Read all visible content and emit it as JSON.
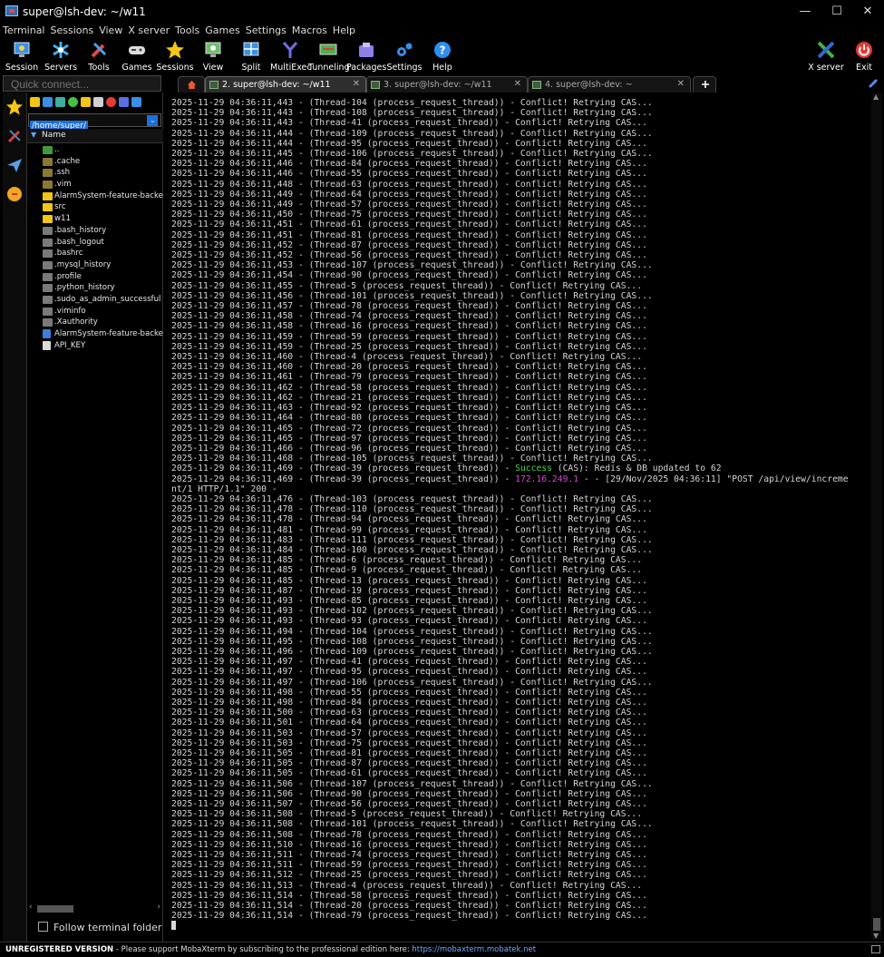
{
  "window": {
    "title": "super@lsh-dev: ~/w11",
    "controls": [
      "—",
      "☐",
      "✕"
    ]
  },
  "menu": [
    "Terminal",
    "Sessions",
    "View",
    "X server",
    "Tools",
    "Games",
    "Settings",
    "Macros",
    "Help"
  ],
  "toolbar": {
    "left": [
      "Session",
      "Servers",
      "Tools",
      "Games",
      "Sessions",
      "View",
      "Split",
      "MultiExec",
      "Tunneling",
      "Packages",
      "Settings",
      "Help"
    ],
    "right": [
      "X server",
      "Exit"
    ]
  },
  "quick_connect": {
    "placeholder": "Quick connect..."
  },
  "tabs": [
    {
      "label": "2. super@lsh-dev: ~/w11",
      "active": true
    },
    {
      "label": "3. super@lsh-dev: ~/w11",
      "active": false
    },
    {
      "label": "4. super@lsh-dev: ~",
      "active": false
    }
  ],
  "sidebar": {
    "path": "/home/super/",
    "column_header": "Name",
    "files": [
      {
        "name": "..",
        "type": "up"
      },
      {
        "name": ".cache",
        "type": "dimfolder"
      },
      {
        "name": ".ssh",
        "type": "dimfolder"
      },
      {
        "name": ".vim",
        "type": "dimfolder"
      },
      {
        "name": "AlarmSystem-feature-backen...",
        "type": "folder"
      },
      {
        "name": "src",
        "type": "folder"
      },
      {
        "name": "w11",
        "type": "folder"
      },
      {
        "name": ".bash_history",
        "type": "file"
      },
      {
        "name": ".bash_logout",
        "type": "file"
      },
      {
        "name": ".bashrc",
        "type": "file"
      },
      {
        "name": ".mysql_history",
        "type": "file"
      },
      {
        "name": ".profile",
        "type": "file"
      },
      {
        "name": ".python_history",
        "type": "file"
      },
      {
        "name": ".sudo_as_admin_successful",
        "type": "file"
      },
      {
        "name": ".viminfo",
        "type": "file"
      },
      {
        "name": ".Xauthority",
        "type": "file"
      },
      {
        "name": "AlarmSystem-feature-backen...",
        "type": "zip"
      },
      {
        "name": "API_KEY",
        "type": "doc"
      }
    ],
    "follow_label": "Follow terminal folder"
  },
  "terminal": {
    "lines_before": [
      "2025-11-29 04:36:11,443 - (Thread-104 (process_request_thread)) - Conflict! Retrying CAS...",
      "2025-11-29 04:36:11,443 - (Thread-108 (process_request_thread)) - Conflict! Retrying CAS...",
      "2025-11-29 04:36:11,443 - (Thread-41 (process_request_thread)) - Conflict! Retrying CAS...",
      "2025-11-29 04:36:11,444 - (Thread-109 (process_request_thread)) - Conflict! Retrying CAS...",
      "2025-11-29 04:36:11,444 - (Thread-95 (process_request_thread)) - Conflict! Retrying CAS...",
      "2025-11-29 04:36:11,445 - (Thread-106 (process_request_thread)) - Conflict! Retrying CAS...",
      "2025-11-29 04:36:11,446 - (Thread-84 (process_request_thread)) - Conflict! Retrying CAS...",
      "2025-11-29 04:36:11,446 - (Thread-55 (process_request_thread)) - Conflict! Retrying CAS...",
      "2025-11-29 04:36:11,448 - (Thread-63 (process_request_thread)) - Conflict! Retrying CAS...",
      "2025-11-29 04:36:11,449 - (Thread-64 (process_request_thread)) - Conflict! Retrying CAS...",
      "2025-11-29 04:36:11,449 - (Thread-57 (process_request_thread)) - Conflict! Retrying CAS...",
      "2025-11-29 04:36:11,450 - (Thread-75 (process_request_thread)) - Conflict! Retrying CAS...",
      "2025-11-29 04:36:11,451 - (Thread-61 (process_request_thread)) - Conflict! Retrying CAS...",
      "2025-11-29 04:36:11,451 - (Thread-81 (process_request_thread)) - Conflict! Retrying CAS...",
      "2025-11-29 04:36:11,452 - (Thread-87 (process_request_thread)) - Conflict! Retrying CAS...",
      "2025-11-29 04:36:11,452 - (Thread-56 (process_request_thread)) - Conflict! Retrying CAS...",
      "2025-11-29 04:36:11,453 - (Thread-107 (process_request_thread)) - Conflict! Retrying CAS...",
      "2025-11-29 04:36:11,454 - (Thread-90 (process_request_thread)) - Conflict! Retrying CAS...",
      "2025-11-29 04:36:11,455 - (Thread-5 (process_request_thread)) - Conflict! Retrying CAS...",
      "2025-11-29 04:36:11,456 - (Thread-101 (process_request_thread)) - Conflict! Retrying CAS...",
      "2025-11-29 04:36:11,457 - (Thread-78 (process_request_thread)) - Conflict! Retrying CAS...",
      "2025-11-29 04:36:11,458 - (Thread-74 (process_request_thread)) - Conflict! Retrying CAS...",
      "2025-11-29 04:36:11,458 - (Thread-16 (process_request_thread)) - Conflict! Retrying CAS...",
      "2025-11-29 04:36:11,459 - (Thread-59 (process_request_thread)) - Conflict! Retrying CAS...",
      "2025-11-29 04:36:11,459 - (Thread-25 (process_request_thread)) - Conflict! Retrying CAS...",
      "2025-11-29 04:36:11,460 - (Thread-4 (process_request_thread)) - Conflict! Retrying CAS...",
      "2025-11-29 04:36:11,460 - (Thread-20 (process_request_thread)) - Conflict! Retrying CAS...",
      "2025-11-29 04:36:11,461 - (Thread-79 (process_request_thread)) - Conflict! Retrying CAS...",
      "2025-11-29 04:36:11,462 - (Thread-58 (process_request_thread)) - Conflict! Retrying CAS...",
      "2025-11-29 04:36:11,462 - (Thread-21 (process_request_thread)) - Conflict! Retrying CAS...",
      "2025-11-29 04:36:11,463 - (Thread-92 (process_request_thread)) - Conflict! Retrying CAS...",
      "2025-11-29 04:36:11,464 - (Thread-80 (process_request_thread)) - Conflict! Retrying CAS...",
      "2025-11-29 04:36:11,465 - (Thread-72 (process_request_thread)) - Conflict! Retrying CAS...",
      "2025-11-29 04:36:11,465 - (Thread-97 (process_request_thread)) - Conflict! Retrying CAS...",
      "2025-11-29 04:36:11,466 - (Thread-96 (process_request_thread)) - Conflict! Retrying CAS...",
      "2025-11-29 04:36:11,468 - (Thread-105 (process_request_thread)) - Conflict! Retrying CAS..."
    ],
    "success_line": {
      "prefix": "2025-11-29 04:36:11,469 - (Thread-39 (process_request_thread)) - ",
      "success": "Success",
      "rest": " (CAS): Redis & DB updated to 62"
    },
    "http_line": {
      "prefix": "2025-11-29 04:36:11,469 - (Thread-39 (process_request_thread)) - ",
      "ip": "172.16.249.1",
      "rest": " - - [29/Nov/2025 04:36:11] \"POST /api/view/increme",
      "wrap": "nt/1 HTTP/1.1\" 200 -"
    },
    "lines_after": [
      "2025-11-29 04:36:11,476 - (Thread-103 (process_request_thread)) - Conflict! Retrying CAS...",
      "2025-11-29 04:36:11,478 - (Thread-110 (process_request_thread)) - Conflict! Retrying CAS...",
      "2025-11-29 04:36:11,478 - (Thread-94 (process_request_thread)) - Conflict! Retrying CAS...",
      "2025-11-29 04:36:11,481 - (Thread-99 (process_request_thread)) - Conflict! Retrying CAS...",
      "2025-11-29 04:36:11,483 - (Thread-111 (process_request_thread)) - Conflict! Retrying CAS...",
      "2025-11-29 04:36:11,484 - (Thread-100 (process_request_thread)) - Conflict! Retrying CAS...",
      "2025-11-29 04:36:11,485 - (Thread-6 (process_request_thread)) - Conflict! Retrying CAS...",
      "2025-11-29 04:36:11,485 - (Thread-9 (process_request_thread)) - Conflict! Retrying CAS...",
      "2025-11-29 04:36:11,485 - (Thread-13 (process_request_thread)) - Conflict! Retrying CAS...",
      "2025-11-29 04:36:11,487 - (Thread-19 (process_request_thread)) - Conflict! Retrying CAS...",
      "2025-11-29 04:36:11,493 - (Thread-85 (process_request_thread)) - Conflict! Retrying CAS...",
      "2025-11-29 04:36:11,493 - (Thread-102 (process_request_thread)) - Conflict! Retrying CAS...",
      "2025-11-29 04:36:11,493 - (Thread-93 (process_request_thread)) - Conflict! Retrying CAS...",
      "2025-11-29 04:36:11,494 - (Thread-104 (process_request_thread)) - Conflict! Retrying CAS...",
      "2025-11-29 04:36:11,495 - (Thread-108 (process_request_thread)) - Conflict! Retrying CAS...",
      "2025-11-29 04:36:11,496 - (Thread-109 (process_request_thread)) - Conflict! Retrying CAS...",
      "2025-11-29 04:36:11,497 - (Thread-41 (process_request_thread)) - Conflict! Retrying CAS...",
      "2025-11-29 04:36:11,497 - (Thread-95 (process_request_thread)) - Conflict! Retrying CAS...",
      "2025-11-29 04:36:11,497 - (Thread-106 (process_request_thread)) - Conflict! Retrying CAS...",
      "2025-11-29 04:36:11,498 - (Thread-55 (process_request_thread)) - Conflict! Retrying CAS...",
      "2025-11-29 04:36:11,498 - (Thread-84 (process_request_thread)) - Conflict! Retrying CAS...",
      "2025-11-29 04:36:11,500 - (Thread-63 (process_request_thread)) - Conflict! Retrying CAS...",
      "2025-11-29 04:36:11,501 - (Thread-64 (process_request_thread)) - Conflict! Retrying CAS...",
      "2025-11-29 04:36:11,503 - (Thread-57 (process_request_thread)) - Conflict! Retrying CAS...",
      "2025-11-29 04:36:11,503 - (Thread-75 (process_request_thread)) - Conflict! Retrying CAS...",
      "2025-11-29 04:36:11,505 - (Thread-81 (process_request_thread)) - Conflict! Retrying CAS...",
      "2025-11-29 04:36:11,505 - (Thread-87 (process_request_thread)) - Conflict! Retrying CAS...",
      "2025-11-29 04:36:11,505 - (Thread-61 (process_request_thread)) - Conflict! Retrying CAS...",
      "2025-11-29 04:36:11,506 - (Thread-107 (process_request_thread)) - Conflict! Retrying CAS...",
      "2025-11-29 04:36:11,506 - (Thread-90 (process_request_thread)) - Conflict! Retrying CAS...",
      "2025-11-29 04:36:11,507 - (Thread-56 (process_request_thread)) - Conflict! Retrying CAS...",
      "2025-11-29 04:36:11,508 - (Thread-5 (process_request_thread)) - Conflict! Retrying CAS...",
      "2025-11-29 04:36:11,508 - (Thread-101 (process_request_thread)) - Conflict! Retrying CAS...",
      "2025-11-29 04:36:11,508 - (Thread-78 (process_request_thread)) - Conflict! Retrying CAS...",
      "2025-11-29 04:36:11,510 - (Thread-16 (process_request_thread)) - Conflict! Retrying CAS...",
      "2025-11-29 04:36:11,511 - (Thread-74 (process_request_thread)) - Conflict! Retrying CAS...",
      "2025-11-29 04:36:11,511 - (Thread-59 (process_request_thread)) - Conflict! Retrying CAS...",
      "2025-11-29 04:36:11,512 - (Thread-25 (process_request_thread)) - Conflict! Retrying CAS...",
      "2025-11-29 04:36:11,513 - (Thread-4 (process_request_thread)) - Conflict! Retrying CAS...",
      "2025-11-29 04:36:11,514 - (Thread-58 (process_request_thread)) - Conflict! Retrying CAS...",
      "2025-11-29 04:36:11,514 - (Thread-20 (process_request_thread)) - Conflict! Retrying CAS...",
      "2025-11-29 04:36:11,514 - (Thread-79 (process_request_thread)) - Conflict! Retrying CAS..."
    ]
  },
  "status_bar": {
    "bold": "UNREGISTERED VERSION",
    "message": " - Please support MobaXterm by subscribing to the professional edition here: ",
    "link": "https://mobaxterm.mobatek.net"
  },
  "colors": {
    "success": "#4dd34d",
    "ip": "#d24ad2",
    "accent": "#1e6fd9"
  }
}
